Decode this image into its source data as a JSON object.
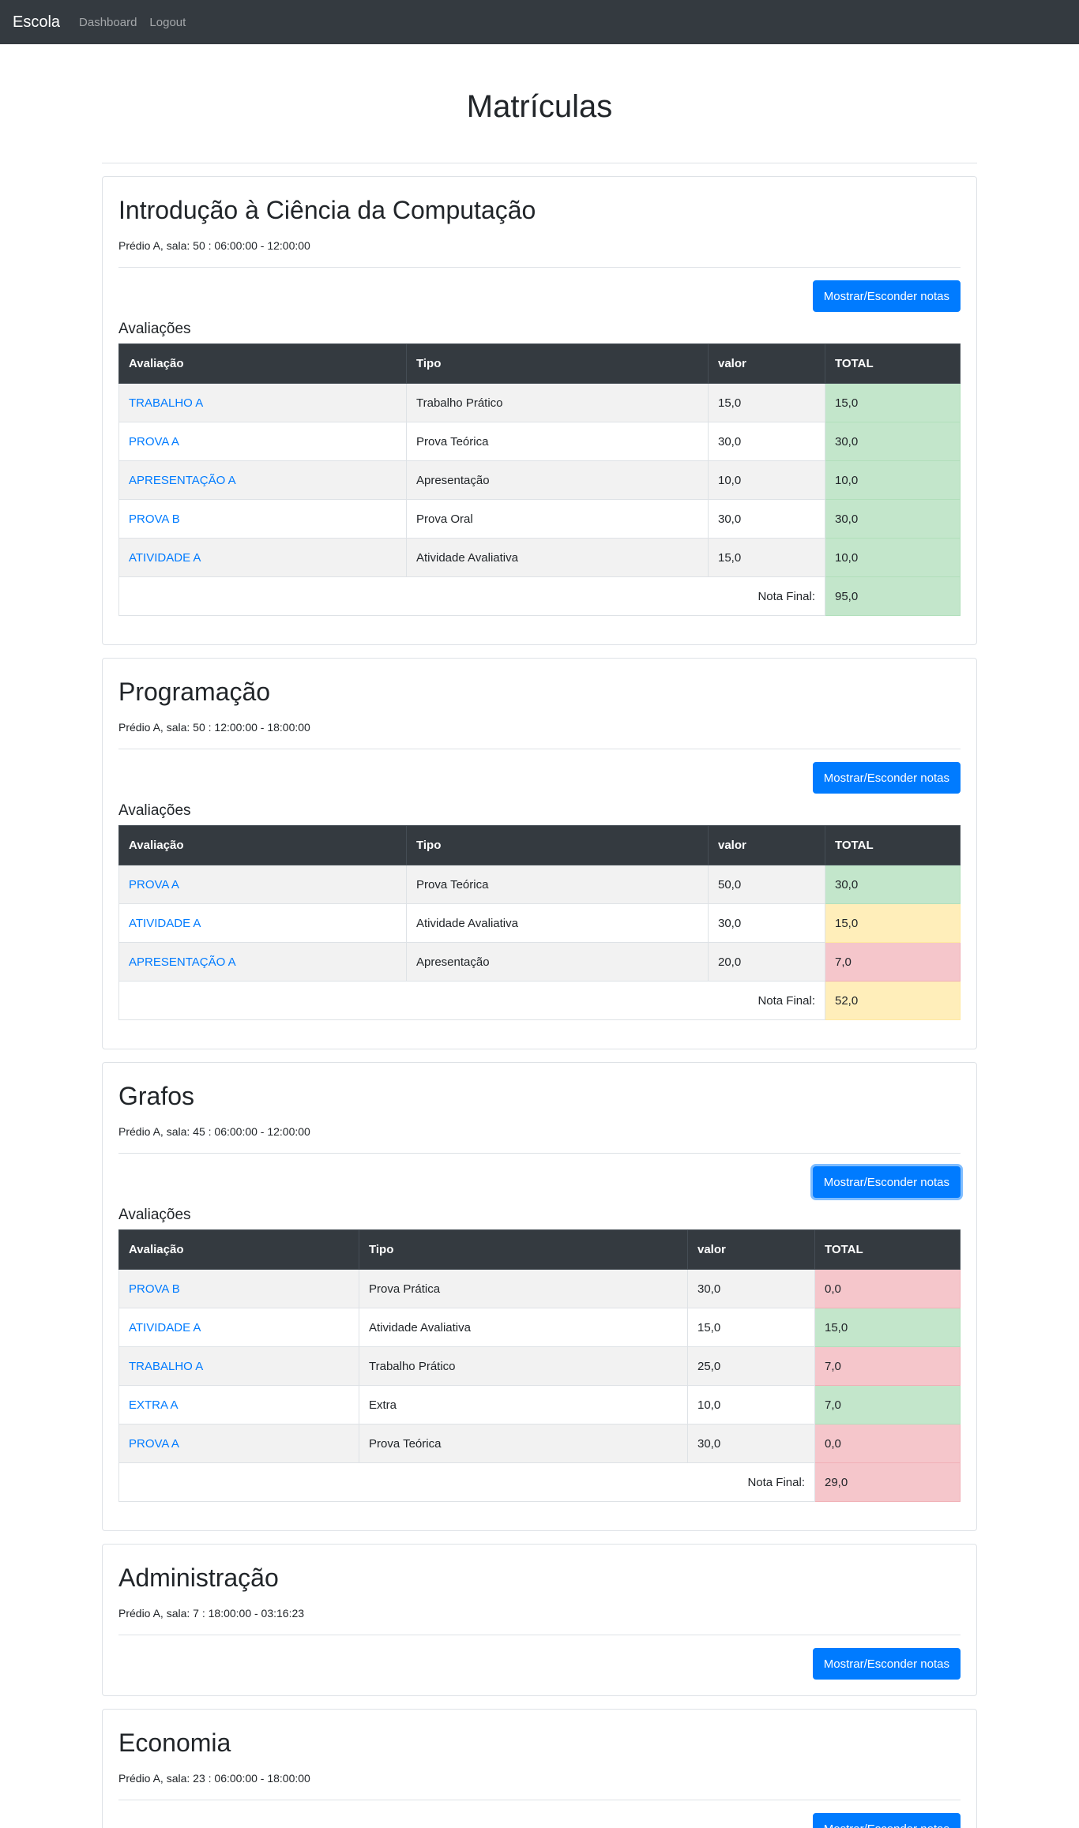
{
  "navbar": {
    "brand": "Escola",
    "links": [
      "Dashboard",
      "Logout"
    ]
  },
  "page_title": "Matrículas",
  "button_label": "Mostrar/Esconder notas",
  "section_label": "Avaliações",
  "columns": [
    "Avaliação",
    "Tipo",
    "valor",
    "TOTAL"
  ],
  "final_label": "Nota Final:",
  "colors": {
    "green": "#c3e6cb",
    "yellow": "#ffeeba",
    "red": "#f5c6cb",
    "primary": "#007bff",
    "dark": "#343a40"
  },
  "courses": [
    {
      "name": "Introdução à Ciência da Computação",
      "info": "Prédio A, sala: 50 : 06:00:00 - 12:00:00",
      "rows": [
        {
          "avaliacao": "TRABALHO A",
          "tipo": "Trabalho Prático",
          "valor": "15,0",
          "total": "15,0",
          "status": "green"
        },
        {
          "avaliacao": "PROVA A",
          "tipo": "Prova Teórica",
          "valor": "30,0",
          "total": "30,0",
          "status": "green"
        },
        {
          "avaliacao": "APRESENTAÇÃO A",
          "tipo": "Apresentação",
          "valor": "10,0",
          "total": "10,0",
          "status": "green"
        },
        {
          "avaliacao": "PROVA B",
          "tipo": "Prova Oral",
          "valor": "30,0",
          "total": "30,0",
          "status": "green"
        },
        {
          "avaliacao": "ATIVIDADE A",
          "tipo": "Atividade Avaliativa",
          "valor": "15,0",
          "total": "10,0",
          "status": "green"
        }
      ],
      "final": "95,0",
      "final_status": "green"
    },
    {
      "name": "Programação",
      "info": "Prédio A, sala: 50 : 12:00:00 - 18:00:00",
      "rows": [
        {
          "avaliacao": "PROVA A",
          "tipo": "Prova Teórica",
          "valor": "50,0",
          "total": "30,0",
          "status": "green"
        },
        {
          "avaliacao": "ATIVIDADE A",
          "tipo": "Atividade Avaliativa",
          "valor": "30,0",
          "total": "15,0",
          "status": "yellow"
        },
        {
          "avaliacao": "APRESENTAÇÃO A",
          "tipo": "Apresentação",
          "valor": "20,0",
          "total": "7,0",
          "status": "red"
        }
      ],
      "final": "52,0",
      "final_status": "yellow"
    },
    {
      "name": "Grafos",
      "info": "Prédio A, sala: 45 : 06:00:00 - 12:00:00",
      "rows": [
        {
          "avaliacao": "PROVA B",
          "tipo": "Prova Prática",
          "valor": "30,0",
          "total": "0,0",
          "status": "red"
        },
        {
          "avaliacao": "ATIVIDADE A",
          "tipo": "Atividade Avaliativa",
          "valor": "15,0",
          "total": "15,0",
          "status": "green"
        },
        {
          "avaliacao": "TRABALHO A",
          "tipo": "Trabalho Prático",
          "valor": "25,0",
          "total": "7,0",
          "status": "red"
        },
        {
          "avaliacao": "EXTRA A",
          "tipo": "Extra",
          "valor": "10,0",
          "total": "7,0",
          "status": "green"
        },
        {
          "avaliacao": "PROVA A",
          "tipo": "Prova Teórica",
          "valor": "30,0",
          "total": "0,0",
          "status": "red"
        }
      ],
      "final": "29,0",
      "final_status": "red"
    },
    {
      "name": "Administração",
      "info": "Prédio A, sala: 7 : 18:00:00 - 03:16:23"
    },
    {
      "name": "Economia",
      "info": "Prédio A, sala: 23 : 06:00:00 - 18:00:00"
    }
  ]
}
